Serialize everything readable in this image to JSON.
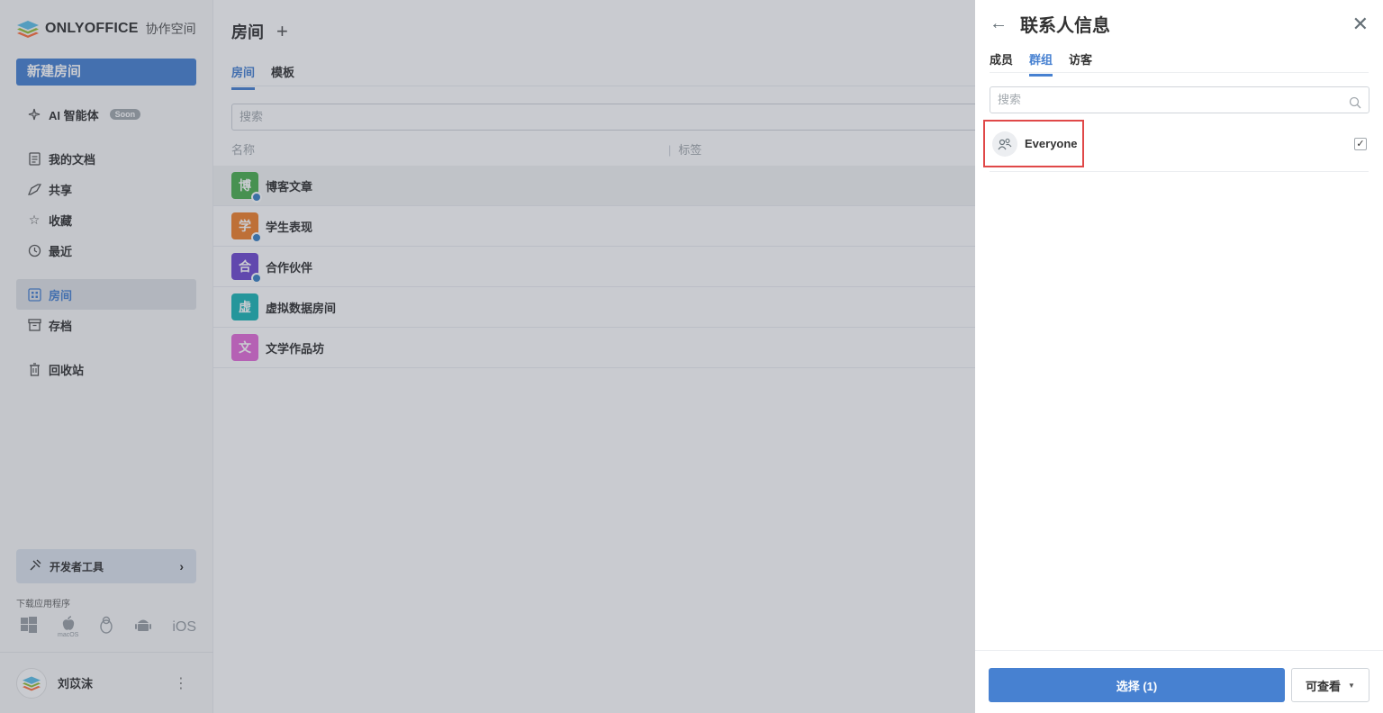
{
  "sidebar": {
    "logo_text": "ONLYOFFICE",
    "logo_sub": "协作空间",
    "new_room": "新建房间",
    "ai_label": "AI 智能体",
    "ai_badge": "Soon",
    "nav": [
      {
        "label": "我的文档",
        "icon": "document-icon"
      },
      {
        "label": "共享",
        "icon": "share-icon"
      },
      {
        "label": "收藏",
        "icon": "star-icon"
      },
      {
        "label": "最近",
        "icon": "recent-icon"
      },
      {
        "label": "房间",
        "icon": "rooms-icon"
      },
      {
        "label": "存档",
        "icon": "archive-icon"
      },
      {
        "label": "回收站",
        "icon": "trash-icon"
      }
    ],
    "devtools": "开发者工具",
    "download_label": "下载应用程序",
    "download_ios": "iOS",
    "download_macos": "macOS",
    "user_name": "刘苡沫"
  },
  "main": {
    "title": "房间",
    "tabs": [
      "房间",
      "模板"
    ],
    "search_placeholder": "搜索",
    "columns": [
      "名称",
      "标签"
    ],
    "rooms": [
      {
        "name": "博客文章",
        "initial": "博",
        "color": "#4caf50",
        "public": true
      },
      {
        "name": "学生表现",
        "initial": "学",
        "color": "#f0812b",
        "public": true
      },
      {
        "name": "合作伙伴",
        "initial": "合",
        "color": "#6f4ad0",
        "public": true
      },
      {
        "name": "虚拟数据房间",
        "initial": "虚",
        "color": "#1cb6b6",
        "public": false
      },
      {
        "name": "文学作品坊",
        "initial": "文",
        "color": "#e36cd8",
        "public": false
      }
    ]
  },
  "panel": {
    "title": "联系人信息",
    "tabs": [
      "成员",
      "群组",
      "访客"
    ],
    "search_placeholder": "搜索",
    "group_name": "Everyone",
    "select_button": "选择 (1)",
    "permission": "可查看"
  },
  "colors": {
    "accent": "#4781d1",
    "highlight_box": "#e04848"
  }
}
